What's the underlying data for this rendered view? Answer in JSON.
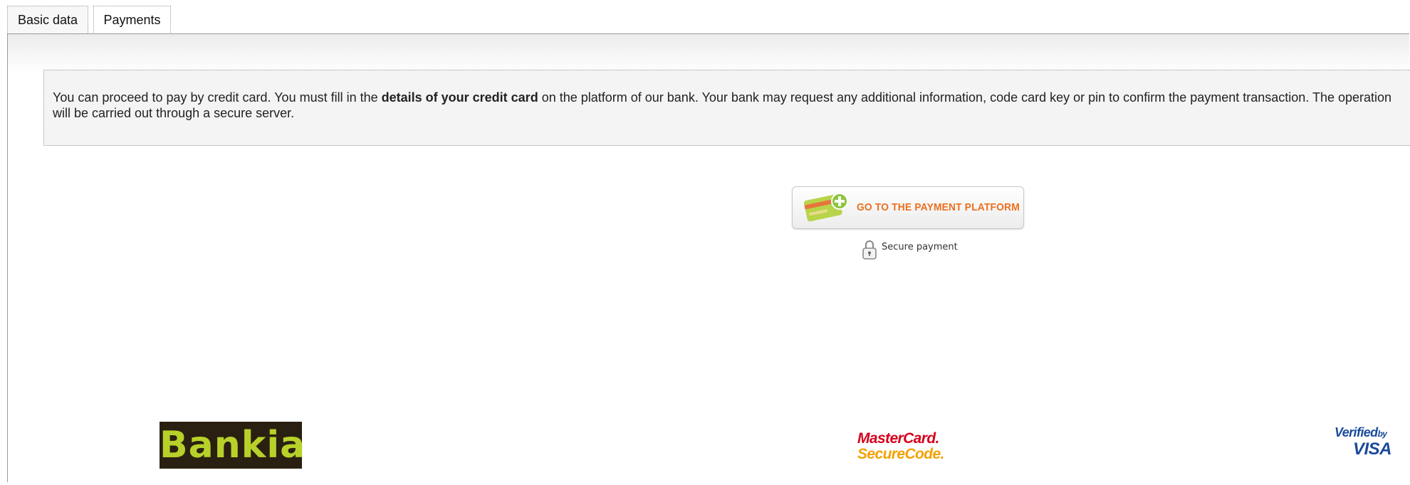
{
  "tabs": [
    {
      "label": "Basic data",
      "active": false
    },
    {
      "label": "Payments",
      "active": true
    }
  ],
  "info": {
    "text_before": "You can proceed to pay by credit card. You must fill in the ",
    "text_bold": "details of your credit card",
    "text_after": " on the platform of our bank. Your bank may request any additional information, code card key or pin to confirm the payment transaction. The operation will be carried out through a secure server."
  },
  "payment_button": {
    "label": "GO TO THE PAYMENT PLATFORM",
    "icon": "credit-card-add-icon"
  },
  "secure_payment": {
    "label": "Secure payment",
    "icon": "lock-icon"
  },
  "logos": {
    "bank": "Bankia",
    "mastercard_line1": "MasterCard.",
    "mastercard_line2": "SecureCode.",
    "visa_line1": "Verified",
    "visa_line1_small": "by",
    "visa_line2": "VISA"
  },
  "colors": {
    "accent_orange": "#ec6f1e",
    "bankia_green": "#b8d12a",
    "mastercard_red": "#d6001c",
    "mastercard_yellow": "#f2a200",
    "visa_blue": "#1a4a9c"
  }
}
